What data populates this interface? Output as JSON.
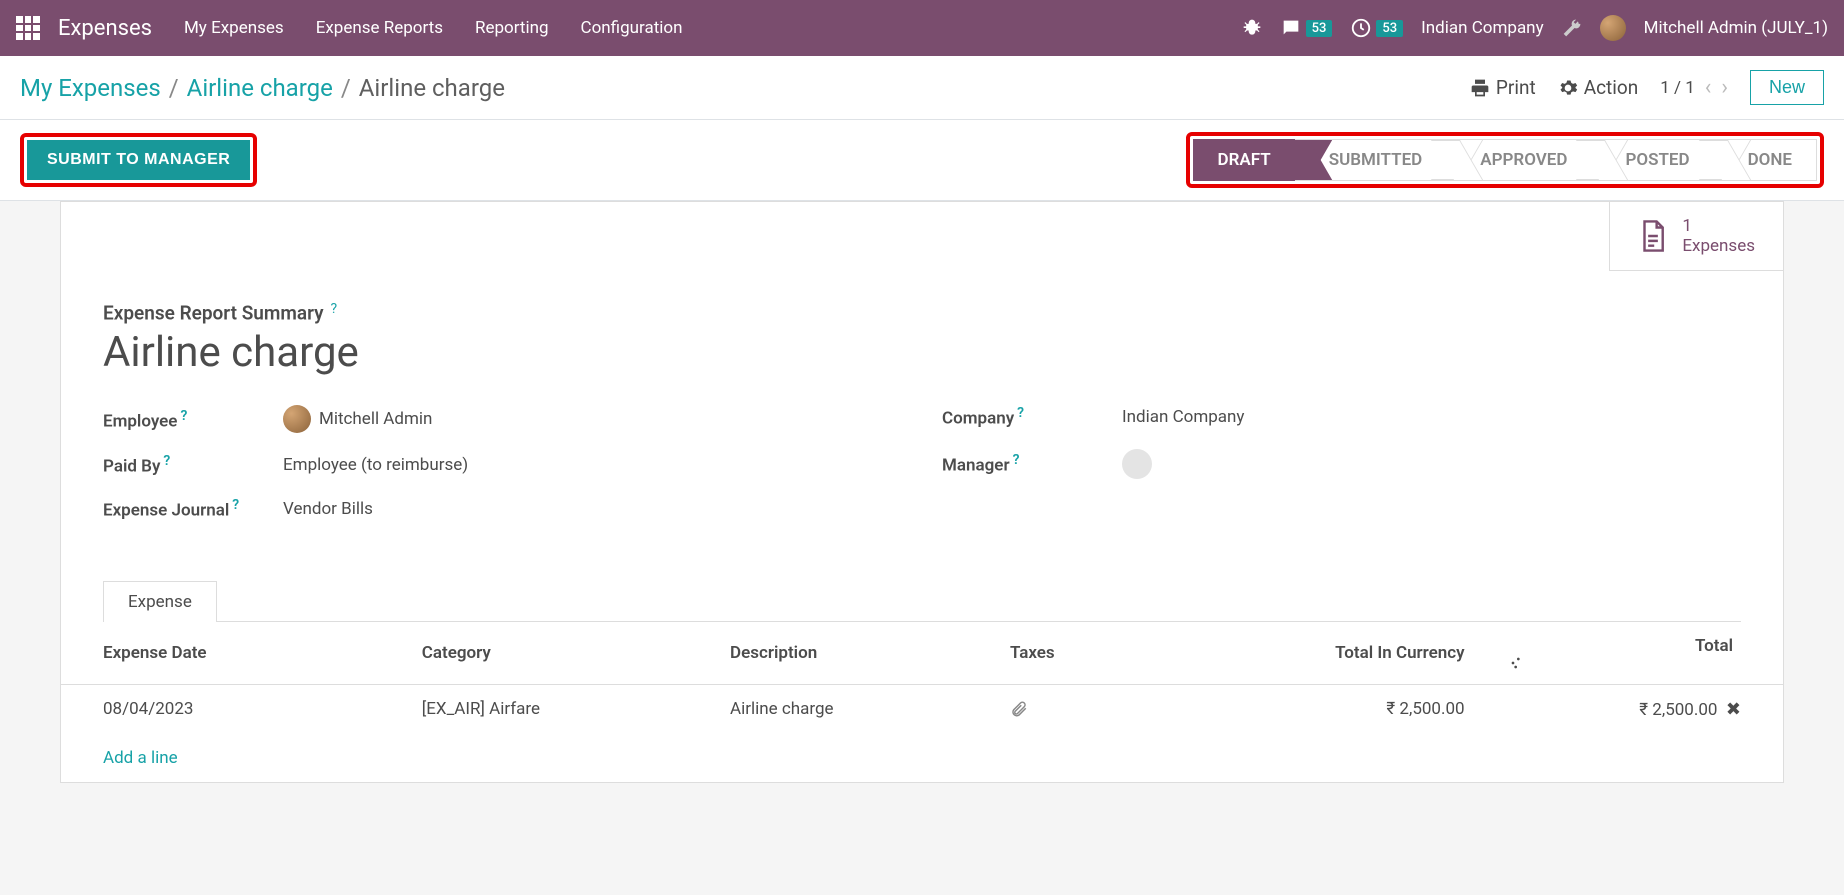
{
  "navbar": {
    "brand": "Expenses",
    "items": [
      "My Expenses",
      "Expense Reports",
      "Reporting",
      "Configuration"
    ],
    "messages_badge": "53",
    "activities_badge": "53",
    "company": "Indian Company",
    "user": "Mitchell Admin (JULY_1)"
  },
  "breadcrumb": {
    "root": "My Expenses",
    "mid": "Airline charge",
    "current": "Airline charge"
  },
  "controls": {
    "print": "Print",
    "action": "Action",
    "pager": "1 / 1",
    "new_label": "New"
  },
  "action_bar": {
    "submit_label": "SUBMIT TO MANAGER"
  },
  "status": {
    "steps": [
      "DRAFT",
      "SUBMITTED",
      "APPROVED",
      "POSTED",
      "DONE"
    ],
    "active_index": 0
  },
  "stat_button": {
    "count": "1",
    "label": "Expenses"
  },
  "form": {
    "summary_label": "Expense Report Summary",
    "summary_title": "Airline charge",
    "labels": {
      "employee": "Employee",
      "company": "Company",
      "paid_by": "Paid By",
      "manager": "Manager",
      "journal": "Expense Journal"
    },
    "values": {
      "employee": "Mitchell Admin",
      "company": "Indian Company",
      "paid_by": "Employee (to reimburse)",
      "journal": "Vendor Bills"
    }
  },
  "tabs": [
    "Expense"
  ],
  "table": {
    "headers": {
      "date": "Expense Date",
      "category": "Category",
      "description": "Description",
      "taxes": "Taxes",
      "total_currency": "Total In Currency",
      "total": "Total"
    },
    "rows": [
      {
        "date": "08/04/2023",
        "category": "[EX_AIR] Airfare",
        "description": "Airline charge",
        "total_currency": "₹ 2,500.00",
        "total": "₹ 2,500.00"
      }
    ],
    "add_line": "Add a line"
  }
}
